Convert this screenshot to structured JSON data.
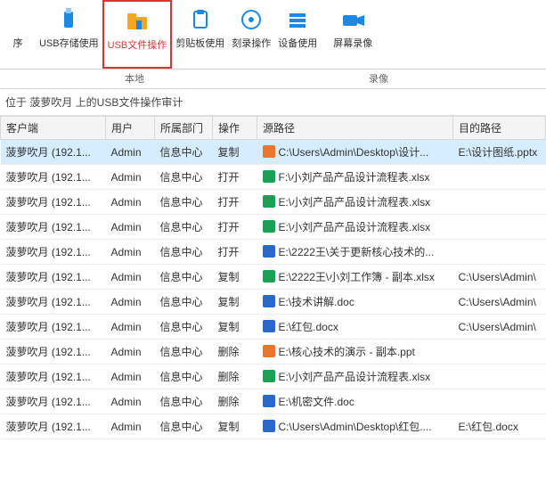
{
  "ribbon": {
    "items": [
      {
        "label": "序"
      },
      {
        "label": "USB存储使用"
      },
      {
        "label": "USB文件操作"
      },
      {
        "label": "剪贴板使用"
      },
      {
        "label": "刻录操作"
      },
      {
        "label": "设备使用"
      },
      {
        "label": "屏幕录像"
      }
    ],
    "group_local": "本地",
    "group_record": "录像"
  },
  "breadcrumb": "位于 菠萝吹月 上的USB文件操作审计",
  "columns": {
    "c0": "客户端",
    "c1": "用户",
    "c2": "所属部门",
    "c3": "操作",
    "c4": "源路径",
    "c5": "目的路径"
  },
  "rows": [
    {
      "c0": "菠萝吹月 (192.1...",
      "c1": "Admin",
      "c2": "信息中心",
      "c3": "复制",
      "ft": "ppt",
      "c4": "C:\\Users\\Admin\\Desktop\\设计...",
      "c5": "E:\\设计图纸.pptx"
    },
    {
      "c0": "菠萝吹月 (192.1...",
      "c1": "Admin",
      "c2": "信息中心",
      "c3": "打开",
      "ft": "xls",
      "c4": "F:\\小刘产品产品设计流程表.xlsx",
      "c5": ""
    },
    {
      "c0": "菠萝吹月 (192.1...",
      "c1": "Admin",
      "c2": "信息中心",
      "c3": "打开",
      "ft": "xls",
      "c4": "E:\\小刘产品产品设计流程表.xlsx",
      "c5": ""
    },
    {
      "c0": "菠萝吹月 (192.1...",
      "c1": "Admin",
      "c2": "信息中心",
      "c3": "打开",
      "ft": "xls",
      "c4": "E:\\小刘产品产品设计流程表.xlsx",
      "c5": ""
    },
    {
      "c0": "菠萝吹月 (192.1...",
      "c1": "Admin",
      "c2": "信息中心",
      "c3": "打开",
      "ft": "doc",
      "c4": "E:\\2222王\\关于更新核心技术的...",
      "c5": ""
    },
    {
      "c0": "菠萝吹月 (192.1...",
      "c1": "Admin",
      "c2": "信息中心",
      "c3": "复制",
      "ft": "xls",
      "c4": "E:\\2222王\\小刘工作簿 - 副本.xlsx",
      "c5": "C:\\Users\\Admin\\"
    },
    {
      "c0": "菠萝吹月 (192.1...",
      "c1": "Admin",
      "c2": "信息中心",
      "c3": "复制",
      "ft": "doc",
      "c4": "E:\\技术讲解.doc",
      "c5": "C:\\Users\\Admin\\"
    },
    {
      "c0": "菠萝吹月 (192.1...",
      "c1": "Admin",
      "c2": "信息中心",
      "c3": "复制",
      "ft": "doc",
      "c4": "E:\\红包.docx",
      "c5": "C:\\Users\\Admin\\"
    },
    {
      "c0": "菠萝吹月 (192.1...",
      "c1": "Admin",
      "c2": "信息中心",
      "c3": "删除",
      "ft": "ppt",
      "c4": "E:\\核心技术的演示 - 副本.ppt",
      "c5": ""
    },
    {
      "c0": "菠萝吹月 (192.1...",
      "c1": "Admin",
      "c2": "信息中心",
      "c3": "删除",
      "ft": "xls",
      "c4": "E:\\小刘产品产品设计流程表.xlsx",
      "c5": ""
    },
    {
      "c0": "菠萝吹月 (192.1...",
      "c1": "Admin",
      "c2": "信息中心",
      "c3": "删除",
      "ft": "doc",
      "c4": "E:\\机密文件.doc",
      "c5": ""
    },
    {
      "c0": "菠萝吹月 (192.1...",
      "c1": "Admin",
      "c2": "信息中心",
      "c3": "复制",
      "ft": "doc",
      "c4": "C:\\Users\\Admin\\Desktop\\红包....",
      "c5": "E:\\红包.docx"
    }
  ]
}
